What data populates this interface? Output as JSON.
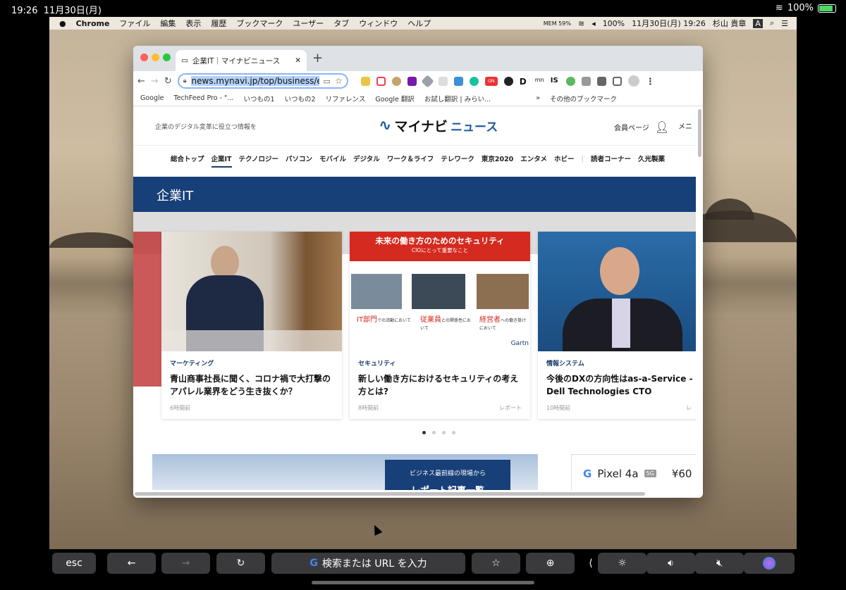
{
  "ipad_status": {
    "time": "19:26",
    "date": "11月30日(月)",
    "battery": "100%"
  },
  "mac_menu": {
    "app": "Chrome",
    "items": [
      "ファイル",
      "編集",
      "表示",
      "履歴",
      "ブックマーク",
      "ユーザー",
      "タブ",
      "ウィンドウ",
      "ヘルプ"
    ],
    "mem": "MEM 59%",
    "battery": "100%",
    "clock": "11月30日(月) 19:26",
    "user": "杉山 貴章",
    "input": "A"
  },
  "browser": {
    "tab_title": "企業IT｜マイナビニュース",
    "url": "news.mynavi.jp/top/business/er",
    "ext_on": "ON",
    "ext_d": "D",
    "ext_mn": "mn",
    "ext_is": "IS",
    "bookmarks": [
      "Google",
      "TechFeed Pro - \"...",
      "いつもの1",
      "いつもの2",
      "リファレンス",
      "Google 翻訳",
      "お試し翻訳 | みらい...",
      "»",
      "その他のブックマーク"
    ]
  },
  "site": {
    "tagline": "企業のデジタル変革に役立つ情報を",
    "logo1": "マイナビ",
    "logo2": "ニュース",
    "member": "会員ページ",
    "menu": "メニ",
    "nav": [
      "総合トップ",
      "企業IT",
      "テクノロジー",
      "パソコン",
      "モバイル",
      "デジタル",
      "ワーク＆ライフ",
      "テレワーク",
      "東京2020",
      "エンタメ",
      "ホビー",
      "|",
      "読者コーナー",
      "久光製薬"
    ],
    "banner": "企業IT",
    "cards": [
      {
        "cat": "マーケティング",
        "title": "青山商事社長に聞く、コロナ禍で大打撃のアパレル業界をどう生き抜くか？",
        "time": "6時間前",
        "rep": ""
      },
      {
        "cat": "セキュリティ",
        "title": "新しい働き方におけるセキュリティの考え方とは?",
        "time": "8時間前",
        "rep": "レポート",
        "img_title": "未来の働き方のためのセキュリティ",
        "img_sub": "CIOにとって重要なこと",
        "img_l1": "IT部門",
        "img_l1s": "での活動において",
        "img_l2": "従業員",
        "img_l2s": "との関係性において",
        "img_l3": "経営者",
        "img_l3s": "への働き掛けにおいて",
        "img_brand": "Gartn"
      },
      {
        "cat": "情報システム",
        "title": "今後のDXの方向性はas-a-Service - Dell Technologies CTO",
        "time": "10時間前",
        "rep": "レ"
      }
    ],
    "biz_label": "ビジネス最前線の現場から",
    "biz_sub": "レポート記事一覧",
    "pixel": "Pixel 4a",
    "pixel_badge": "5G",
    "pixel_price": "¥60"
  },
  "touchbar": {
    "esc": "esc",
    "search": "検索または URL を入力"
  }
}
